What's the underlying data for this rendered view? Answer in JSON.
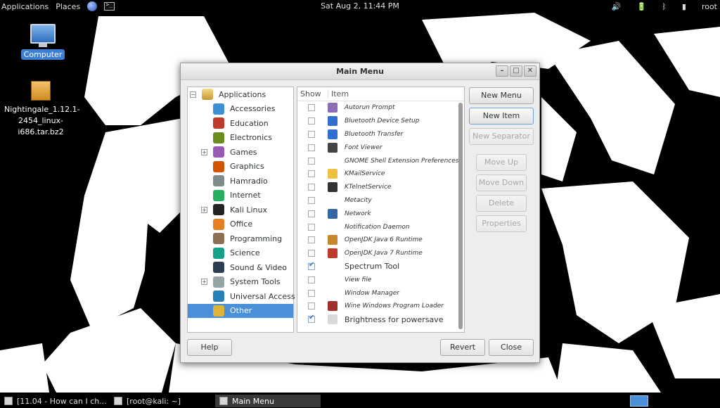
{
  "topbar": {
    "applications": "Applications",
    "places": "Places",
    "clock": "Sat Aug  2, 11:44 PM",
    "user": "root",
    "icons": [
      "globe-icon",
      "terminal-icon",
      "volume-icon",
      "battery-icon",
      "bluetooth-icon",
      "network-icon"
    ]
  },
  "desktop": {
    "computer_label": "Computer",
    "archive_label": "Nightingale_1.12.1-2454_linux-i686.tar.bz2"
  },
  "dialog": {
    "title": "Main Menu",
    "categories": {
      "root": "Applications",
      "items": [
        {
          "label": "Accessories",
          "expandable": false,
          "selected": false
        },
        {
          "label": "Education",
          "expandable": false,
          "selected": false
        },
        {
          "label": "Electronics",
          "expandable": false,
          "selected": false
        },
        {
          "label": "Games",
          "expandable": true,
          "selected": false
        },
        {
          "label": "Graphics",
          "expandable": false,
          "selected": false
        },
        {
          "label": "Hamradio",
          "expandable": false,
          "selected": false
        },
        {
          "label": "Internet",
          "expandable": false,
          "selected": false
        },
        {
          "label": "Kali Linux",
          "expandable": true,
          "selected": false
        },
        {
          "label": "Office",
          "expandable": false,
          "selected": false
        },
        {
          "label": "Programming",
          "expandable": false,
          "selected": false
        },
        {
          "label": "Science",
          "expandable": false,
          "selected": false
        },
        {
          "label": "Sound & Video",
          "expandable": false,
          "selected": false
        },
        {
          "label": "System Tools",
          "expandable": true,
          "selected": false
        },
        {
          "label": "Universal Access",
          "expandable": false,
          "selected": false
        },
        {
          "label": "Other",
          "expandable": false,
          "selected": true
        }
      ]
    },
    "columns": {
      "show": "Show",
      "item": "Item"
    },
    "entries": [
      {
        "label": "Autorun Prompt",
        "shown": false
      },
      {
        "label": "Bluetooth Device Setup",
        "shown": false
      },
      {
        "label": "Bluetooth Transfer",
        "shown": false
      },
      {
        "label": "Font Viewer",
        "shown": false
      },
      {
        "label": "GNOME Shell Extension Preferences",
        "shown": false
      },
      {
        "label": "KMailService",
        "shown": false
      },
      {
        "label": "KTelnetService",
        "shown": false
      },
      {
        "label": "Metacity",
        "shown": false
      },
      {
        "label": "Network",
        "shown": false
      },
      {
        "label": "Notification Daemon",
        "shown": false
      },
      {
        "label": "OpenJDK Java 6 Runtime",
        "shown": false
      },
      {
        "label": "OpenJDK Java 7 Runtime",
        "shown": false
      },
      {
        "label": "Spectrum Tool",
        "shown": true
      },
      {
        "label": "View file",
        "shown": false
      },
      {
        "label": "Window Manager",
        "shown": false
      },
      {
        "label": "Wine Windows Program Loader",
        "shown": false
      },
      {
        "label": "Brightness for powersave",
        "shown": true
      }
    ],
    "buttons": {
      "new_menu": "New Menu",
      "new_item": "New Item",
      "new_separator": "New Separator",
      "move_up": "Move Up",
      "move_down": "Move Down",
      "delete": "Delete",
      "properties": "Properties",
      "help": "Help",
      "revert": "Revert",
      "close": "Close"
    }
  },
  "taskbar": {
    "tasks": [
      {
        "label": "[11.04 - How can I ch...",
        "active": false
      },
      {
        "label": "[root@kali: ~]",
        "active": false
      },
      {
        "label": "Main Menu",
        "active": true
      }
    ]
  },
  "colors": {
    "selection": "#4a90d9",
    "dialog_bg": "#ededed",
    "panel_bg": "#000000"
  }
}
